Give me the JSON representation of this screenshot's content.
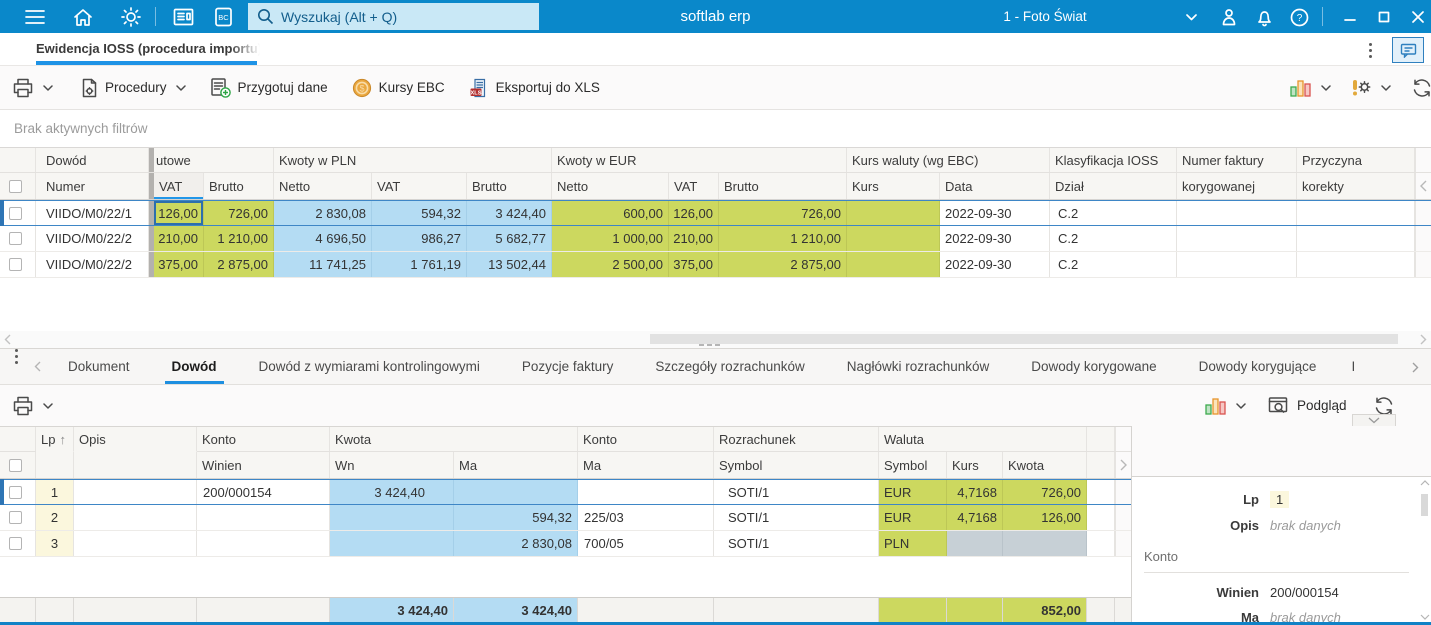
{
  "topbar": {
    "search_placeholder": "Wyszukaj (Alt + Q)",
    "app_name": "softlab erp",
    "company_selector": "1 - Foto Świat"
  },
  "document_tab": {
    "title": "Ewidencja IOSS (procedura importu)"
  },
  "toolbar": {
    "procedures_label": "Procedury",
    "prepare_data_label": "Przygotuj dane",
    "ecb_rates_label": "Kursy EBC",
    "export_xls_label": "Eksportuj do XLS"
  },
  "filter_bar": {
    "text": "Brak aktywnych filtrów"
  },
  "grid1": {
    "group_headers": {
      "dowod": "Dowód",
      "walutowe": "utowe",
      "pln": "Kwoty w PLN",
      "eur": "Kwoty w EUR",
      "kurs_waluty": "Kurs waluty (wg EBC)",
      "klasyfikacja": "Klasyfikacja IOSS",
      "numer_faktury": "Numer faktury",
      "przyczyna": "Przyczyna"
    },
    "sub_headers": {
      "numer": "Numer",
      "vat": "VAT",
      "brutto": "Brutto",
      "netto": "Netto",
      "kurs": "Kurs",
      "data": "Data",
      "dzial": "Dział",
      "korygowanej": "korygowanej",
      "korekty": "korekty"
    },
    "rows": [
      {
        "numer": "VIIDO/M0/22/1",
        "vat_wal": "126,00",
        "brutto_wal": "726,00",
        "netto_pln": "2 830,08",
        "vat_pln": "594,32",
        "brutto_pln": "3 424,40",
        "netto_eur": "600,00",
        "vat_eur": "126,00",
        "brutto_eur": "726,00",
        "kurs": "",
        "data": "2022-09-30",
        "dzial": "C.2",
        "numer_faktury": "",
        "przyczyna": ""
      },
      {
        "numer": "VIIDO/M0/22/2",
        "vat_wal": "210,00",
        "brutto_wal": "1 210,00",
        "netto_pln": "4 696,50",
        "vat_pln": "986,27",
        "brutto_pln": "5 682,77",
        "netto_eur": "1 000,00",
        "vat_eur": "210,00",
        "brutto_eur": "1 210,00",
        "kurs": "",
        "data": "2022-09-30",
        "dzial": "C.2",
        "numer_faktury": "",
        "przyczyna": ""
      },
      {
        "numer": "VIIDO/M0/22/2",
        "vat_wal": "375,00",
        "brutto_wal": "2 875,00",
        "netto_pln": "11 741,25",
        "vat_pln": "1 761,19",
        "brutto_pln": "13 502,44",
        "netto_eur": "2 500,00",
        "vat_eur": "375,00",
        "brutto_eur": "2 875,00",
        "kurs": "",
        "data": "2022-09-30",
        "dzial": "C.2",
        "numer_faktury": "",
        "przyczyna": ""
      }
    ]
  },
  "detail_tabs": {
    "items": [
      "Dokument",
      "Dowód",
      "Dowód z wymiarami kontrolingowymi",
      "Pozycje faktury",
      "Szczegóły rozrachunków",
      "Nagłówki rozrachunków",
      "Dowody korygowane",
      "Dowody korygujące",
      "I"
    ],
    "active": "Dowód"
  },
  "toolbar2": {
    "preview_label": "Podgląd"
  },
  "grid2": {
    "group_headers": {
      "lp": "Lp",
      "opis": "Opis",
      "konto_wn": "Konto",
      "kwota": "Kwota",
      "konto_ma": "Konto",
      "rozrachunek": "Rozrachunek",
      "waluta": "Waluta"
    },
    "sub_headers": {
      "winien": "Winien",
      "wn": "Wn",
      "ma": "Ma",
      "ma2": "Ma",
      "symbol": "Symbol",
      "symbol2": "Symbol",
      "kurs": "Kurs",
      "kwota": "Kwota"
    },
    "rows": [
      {
        "lp": "1",
        "opis": "",
        "konto_winien": "200/000154",
        "wn": "3 424,40",
        "ma": "",
        "konto_ma": "",
        "rozrachunek": "SOTI/1",
        "waluta_symbol": "EUR",
        "kurs": "4,7168",
        "kwota": "726,00"
      },
      {
        "lp": "2",
        "opis": "",
        "konto_winien": "",
        "wn": "",
        "ma": "594,32",
        "konto_ma": "225/03",
        "rozrachunek": "SOTI/1",
        "waluta_symbol": "EUR",
        "kurs": "4,7168",
        "kwota": "126,00"
      },
      {
        "lp": "3",
        "opis": "",
        "konto_winien": "",
        "wn": "",
        "ma": "2 830,08",
        "konto_ma": "700/05",
        "rozrachunek": "SOTI/1",
        "waluta_symbol": "PLN",
        "kurs": "",
        "kwota": ""
      }
    ],
    "footer": {
      "wn": "3 424,40",
      "ma": "3 424,40",
      "kwota": "852,00"
    }
  },
  "detail_panel": {
    "lp_label": "Lp",
    "lp_value": "1",
    "opis_label": "Opis",
    "opis_value": "brak danych",
    "konto_section": "Konto",
    "winien_label": "Winien",
    "winien_value": "200/000154",
    "ma_label": "Ma",
    "ma_value": "brak danych"
  },
  "colors": {
    "topbar": "#0a88ca",
    "tab_underline": "#1e93e6",
    "cell_green": "#ccd85f",
    "cell_blue": "#b4dcf3",
    "cell_gray": "#c7d0d6",
    "lp_yellow": "#fbf7dd",
    "selection": "#2e75b5",
    "window_bottom": "#1082c6"
  }
}
